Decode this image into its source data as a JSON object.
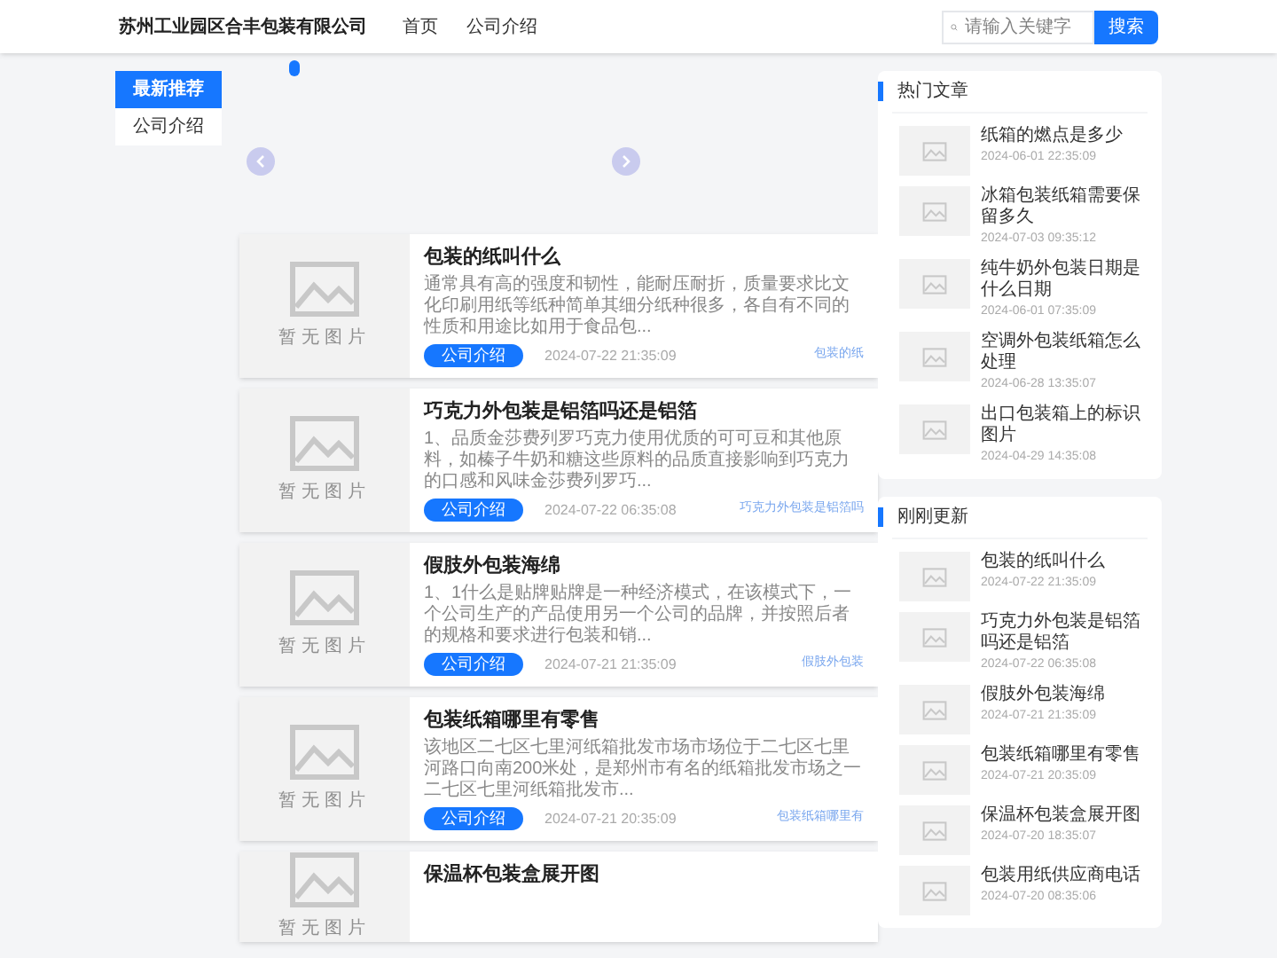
{
  "header": {
    "logo": "苏州工业园区合丰包装有限公司",
    "nav": [
      {
        "label": "首页",
        "selected": false
      },
      {
        "label": "公司介绍",
        "selected": false
      }
    ],
    "search": {
      "placeholder": "请输入关键字",
      "button": "搜索"
    }
  },
  "sidebar": {
    "items": [
      {
        "label": "最新推荐",
        "selected": true
      },
      {
        "label": "公司介绍",
        "selected": false
      }
    ]
  },
  "articles": [
    {
      "image": "暂无图片",
      "title": "包装的纸叫什么",
      "excerpt": "通常具有高的强度和韧性，能耐压耐折，质量要求比文化印刷用纸等纸种简单其细分纸种很多，各自有不同的性质和用途比如用于食品包...",
      "category": "公司介绍",
      "date": "2024-07-22 21:35:09",
      "tag": "包装的纸"
    },
    {
      "image": "暂无图片",
      "title": "巧克力外包装是铝箔吗还是铝箔",
      "excerpt": "1、品质金莎费列罗巧克力使用优质的可可豆和其他原料，如榛子牛奶和糖这些原料的品质直接影响到巧克力的口感和风味金莎费列罗巧...",
      "category": "公司介绍",
      "date": "2024-07-22 06:35:08",
      "tag": "巧克力外包装是铝箔吗"
    },
    {
      "image": "暂无图片",
      "title": "假肢外包装海绵",
      "excerpt": "1、1什么是贴牌贴牌是一种经济模式，在该模式下，一个公司生产的产品使用另一个公司的品牌，并按照后者的规格和要求进行包装和销...",
      "category": "公司介绍",
      "date": "2024-07-21 21:35:09",
      "tag": "假肢外包装"
    },
    {
      "image": "暂无图片",
      "title": "包装纸箱哪里有零售",
      "excerpt": "该地区二七区七里河纸箱批发市场市场位于二七区七里河路口向南200米处，是郑州市有名的纸箱批发市场之一二七区七里河纸箱批发市...",
      "category": "公司介绍",
      "date": "2024-07-21 20:35:09",
      "tag": "包装纸箱哪里有"
    },
    {
      "image": "暂无图片",
      "title": "保温杯包装盒展开图"
    }
  ],
  "hot": {
    "title": "热门文章",
    "items": [
      {
        "title": "纸箱的燃点是多少",
        "date": "2024-06-01 22:35:09"
      },
      {
        "title": "冰箱包装纸箱需要保留多久",
        "date": "2024-07-03 09:35:12"
      },
      {
        "title": "纯牛奶外包装日期是什么日期",
        "date": "2024-06-01 07:35:09"
      },
      {
        "title": "空调外包装纸箱怎么处理",
        "date": "2024-06-28 13:35:07"
      },
      {
        "title": "出口包装箱上的标识图片",
        "date": "2024-04-29 14:35:08"
      }
    ]
  },
  "recent": {
    "title": "刚刚更新",
    "items": [
      {
        "title": "包装的纸叫什么",
        "date": "2024-07-22 21:35:09"
      },
      {
        "title": "巧克力外包装是铝箔吗还是铝箔",
        "date": "2024-07-22 06:35:08"
      },
      {
        "title": "假肢外包装海绵",
        "date": "2024-07-21 21:35:09"
      },
      {
        "title": "包装纸箱哪里有零售",
        "date": "2024-07-21 20:35:09"
      },
      {
        "title": "保温杯包装盒展开图",
        "date": "2024-07-20 18:35:07"
      },
      {
        "title": "包装用纸供应商电话",
        "date": "2024-07-20 08:35:06"
      }
    ]
  }
}
